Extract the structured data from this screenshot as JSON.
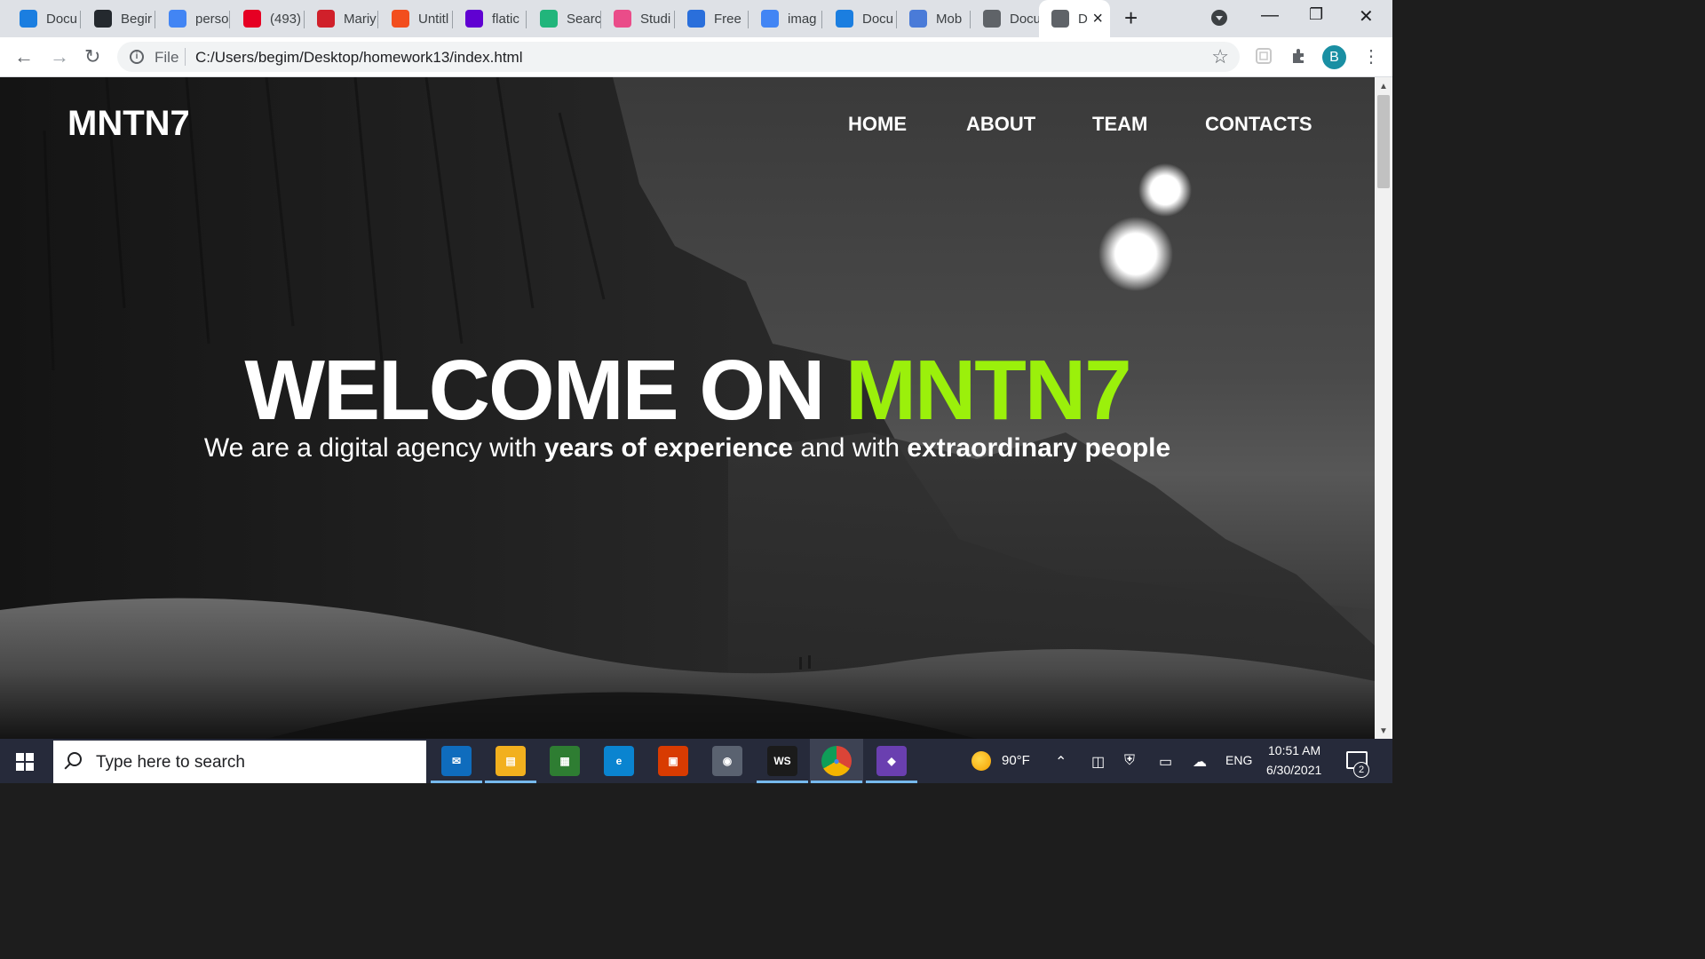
{
  "browser": {
    "tabs": [
      {
        "title": "Docu",
        "icon": "webstorm-icon",
        "color": "#1b7ee0"
      },
      {
        "title": "Begir",
        "icon": "github-icon",
        "color": "#24292e"
      },
      {
        "title": "perso",
        "icon": "google-icon",
        "color": "#4285f4"
      },
      {
        "title": "(493)",
        "icon": "pinterest-icon",
        "color": "#e60023"
      },
      {
        "title": "Mariy",
        "icon": "red-app-icon",
        "color": "#d0202a"
      },
      {
        "title": "Untitl",
        "icon": "figma-icon",
        "color": "#f24e1e"
      },
      {
        "title": "flatic",
        "icon": "yahoo-icon",
        "color": "#6001d2"
      },
      {
        "title": "Searc",
        "icon": "green-check-icon",
        "color": "#21b57b"
      },
      {
        "title": "Studi",
        "icon": "dribbble-icon",
        "color": "#ea4c89"
      },
      {
        "title": "Free",
        "icon": "blue-bot-icon",
        "color": "#2a6fdb"
      },
      {
        "title": "imag",
        "icon": "google-icon",
        "color": "#4285f4"
      },
      {
        "title": "Docu",
        "icon": "webstorm-icon",
        "color": "#1b7ee0"
      },
      {
        "title": "Mob",
        "icon": "flag-icon",
        "color": "#4a7bd8"
      },
      {
        "title": "Docu",
        "icon": "globe-icon",
        "color": "#5f6368"
      },
      {
        "title": "D",
        "icon": "globe-icon",
        "color": "#5f6368",
        "active": true
      }
    ],
    "file_label": "File",
    "url": "C:/Users/begim/Desktop/homework13/index.html",
    "profile_initial": "B"
  },
  "site": {
    "logo": "MNTN7",
    "nav": [
      "HOME",
      "ABOUT",
      "TEAM",
      "CONTACTS"
    ],
    "hero": {
      "title_main": "WELCOME ON",
      "title_accent": "MNTN7",
      "accent_color": "#9bf00b",
      "sub_1": "We are a digital agency with",
      "sub_bold_1": "years of experience",
      "sub_2": "and with",
      "sub_bold_2": "extraordinary people"
    }
  },
  "taskbar": {
    "search_placeholder": "Type here to search",
    "apps": [
      "mail-icon",
      "file-explorer-icon",
      "store-icon",
      "edge-icon",
      "office-icon",
      "camera-icon",
      "webstorm-icon",
      "chrome-icon",
      "git-icon"
    ],
    "weather": "90°F",
    "language": "ENG",
    "time": "10:51 AM",
    "date": "6/30/2021",
    "notification_count": "2"
  }
}
